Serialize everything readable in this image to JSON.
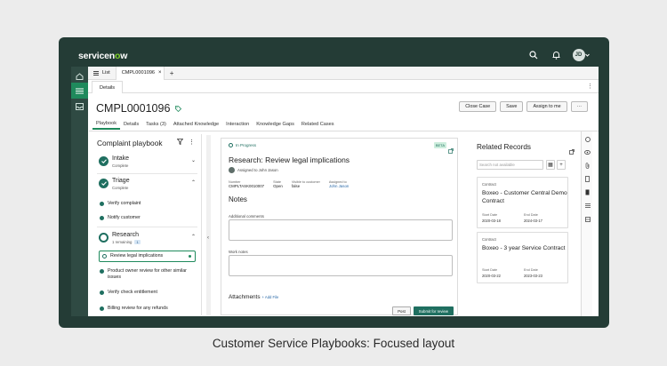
{
  "brand": {
    "logo_text_a": "servicen",
    "logo_text_o": "o",
    "logo_text_b": "w",
    "avatar_initials": "JD"
  },
  "colors": {
    "frame": "#243c36",
    "accent": "#1f6f60",
    "brand_green": "#81d22a",
    "link": "#2b6aa8"
  },
  "tabs": [
    {
      "label": "List"
    },
    {
      "label": "CMPL0001096"
    }
  ],
  "subtab": {
    "label": "Details"
  },
  "record": {
    "number": "CMPL0001096"
  },
  "actions": {
    "close_case": "Close Case",
    "save": "Save",
    "assign_to_me": "Assign to me",
    "more": "···"
  },
  "record_tabs": [
    "Playbook",
    "Details",
    "Tasks (3)",
    "Attached Knowledge",
    "Interaction",
    "Knowledge Gaps",
    "Related Cases"
  ],
  "playbook": {
    "title": "Complaint playbook",
    "stages": [
      {
        "name": "Intake",
        "status": "Complete"
      },
      {
        "name": "Triage",
        "status": "Complete"
      },
      {
        "name": "Research",
        "status": "1 remaining",
        "count": "1"
      }
    ],
    "triage_activities": [
      "Verify complaint",
      "Notify customer"
    ],
    "research_activities": [
      "Review legal implications",
      "Product owner review for other similar issues",
      "Verify check entitlement",
      "Billing review for any refunds"
    ]
  },
  "activity": {
    "status": "In Progress",
    "beta": "BETA",
    "title": "Research: Review legal implications",
    "assigned": "Assigned to John Jason",
    "fields": [
      {
        "label": "Number",
        "value": "CMPLTASK0010007"
      },
      {
        "label": "State",
        "value": "Open"
      },
      {
        "label": "Visible to customer",
        "value": "false"
      },
      {
        "label": "Assigned to",
        "value": "John Jason"
      }
    ],
    "notes_title": "Notes",
    "comments_label": "Additional comments",
    "work_notes_label": "Work notes",
    "attachments_label": "Attachments",
    "add_file": "+ Add File",
    "post": "Post",
    "submit": "Submit for review"
  },
  "related": {
    "title": "Related Records",
    "search_placeholder": "Search not available",
    "cards": [
      {
        "type": "Contract",
        "name": "Boxeo - Customer Central Demo Contract",
        "start_label": "Start Date",
        "start": "2020-03-18",
        "end_label": "End Date",
        "end": "2024-03-17"
      },
      {
        "type": "Contract",
        "name": "Boxeo - 3 year Service Contract",
        "start_label": "Start Date",
        "start": "2020-03-22",
        "end_label": "End Date",
        "end": "2023-03-23"
      }
    ]
  },
  "caption": "Customer Service Playbooks: Focused layout"
}
